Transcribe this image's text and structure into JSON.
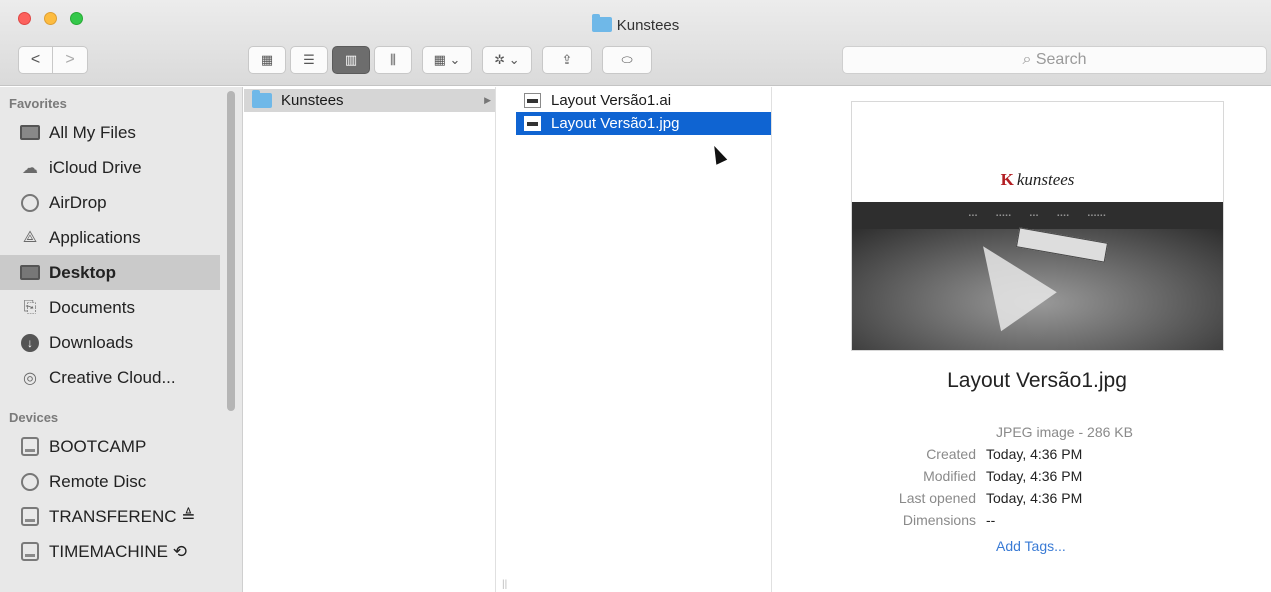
{
  "window": {
    "title": "Kunstees"
  },
  "toolbar": {
    "back": "<",
    "forward": ">",
    "views": [
      "icon-view",
      "list-view",
      "column-view",
      "coverflow-view"
    ],
    "arrange": "arrange-icon",
    "action": "gear-icon",
    "share": "share-icon",
    "tag": "tag-icon"
  },
  "search": {
    "placeholder": "Search"
  },
  "sidebar": {
    "favorites_label": "Favorites",
    "favorites": [
      {
        "label": "All My Files",
        "icon": "all-files-icon"
      },
      {
        "label": "iCloud Drive",
        "icon": "cloud-icon"
      },
      {
        "label": "AirDrop",
        "icon": "airdrop-icon"
      },
      {
        "label": "Applications",
        "icon": "applications-icon"
      },
      {
        "label": "Desktop",
        "icon": "desktop-icon"
      },
      {
        "label": "Documents",
        "icon": "documents-icon"
      },
      {
        "label": "Downloads",
        "icon": "downloads-icon"
      },
      {
        "label": "Creative Cloud...",
        "icon": "creative-cloud-icon"
      }
    ],
    "devices_label": "Devices",
    "devices": [
      {
        "label": "BOOTCAMP",
        "icon": "disk-icon"
      },
      {
        "label": "Remote Disc",
        "icon": "disc-icon"
      },
      {
        "label": "TRANSFERENC ≜",
        "icon": "disk-icon"
      },
      {
        "label": "TIMEMACHINE ⟲",
        "icon": "timemachine-icon"
      }
    ]
  },
  "columns": {
    "col1": [
      {
        "label": "Kunstees"
      }
    ],
    "col2": [
      {
        "label": "Layout Versão1.ai"
      },
      {
        "label": "Layout Versão1.jpg"
      }
    ]
  },
  "preview": {
    "thumb_brand": "kunstees",
    "filename": "Layout Versão1.jpg",
    "type": "JPEG image - 286 KB",
    "meta": [
      {
        "key": "Created",
        "value": "Today, 4:36 PM"
      },
      {
        "key": "Modified",
        "value": "Today, 4:36 PM"
      },
      {
        "key": "Last opened",
        "value": "Today, 4:36 PM"
      },
      {
        "key": "Dimensions",
        "value": "--"
      }
    ],
    "add_tags": "Add Tags..."
  }
}
